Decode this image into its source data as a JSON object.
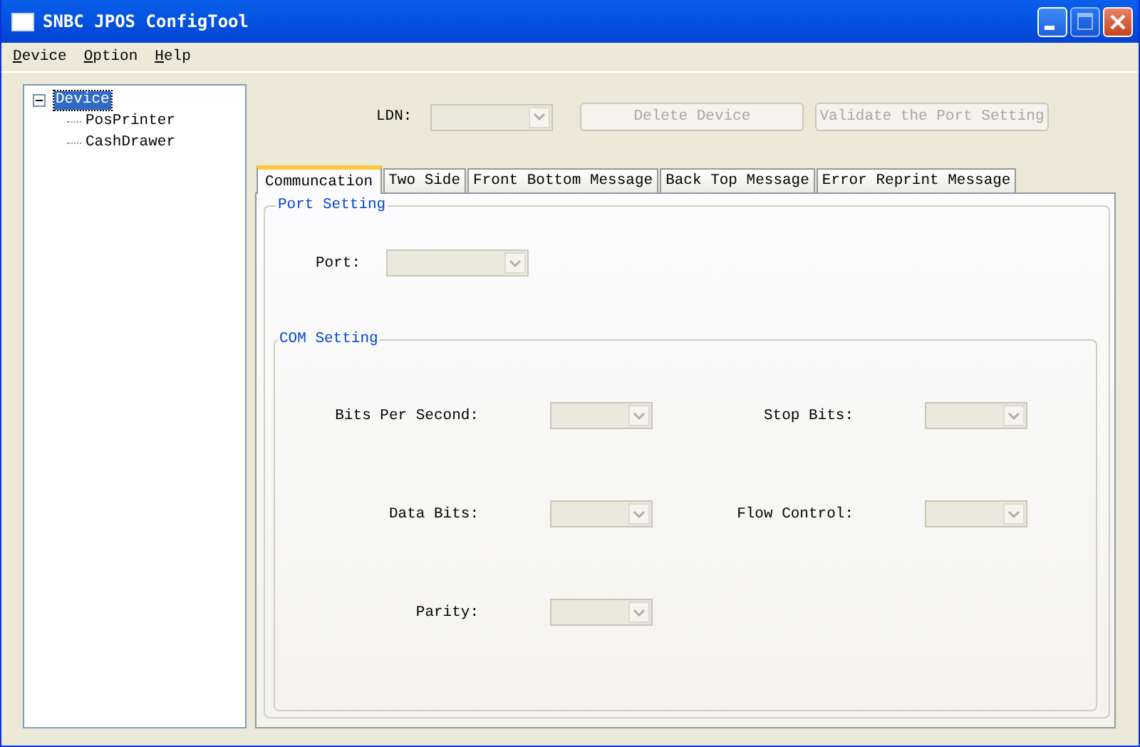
{
  "window": {
    "title": "SNBC JPOS ConfigTool"
  },
  "menu": [
    {
      "label": "Device"
    },
    {
      "label": "Option"
    },
    {
      "label": "Help"
    }
  ],
  "tree": [
    {
      "label": "Device",
      "selected": true,
      "expanded": true,
      "children": [
        {
          "label": "PosPrinter",
          "selected": false
        },
        {
          "label": "CashDrawer",
          "selected": false
        }
      ]
    }
  ],
  "ldn": {
    "label": "LDN:",
    "disabled": true
  },
  "buttons": [
    {
      "label": "Delete Device",
      "disabled": true
    },
    {
      "label": "Validate the Port Setting",
      "disabled": true
    }
  ],
  "tabs": [
    {
      "label": "Communcation",
      "selected": true
    },
    {
      "label": "Two Side",
      "selected": false
    },
    {
      "label": "Front Bottom Message",
      "selected": false
    },
    {
      "label": "Back Top Message",
      "selected": false
    },
    {
      "label": "Error Reprint Message",
      "selected": false
    }
  ],
  "port_setting": {
    "title": "Port Setting",
    "fields": [
      {
        "label": "Port:",
        "disabled": true
      }
    ]
  },
  "com_setting": {
    "title": "COM Setting",
    "fields": [
      {
        "label": "Bits Per Second:",
        "disabled": true
      },
      {
        "label": "Stop Bits:",
        "disabled": true
      },
      {
        "label": "Data Bits:",
        "disabled": true
      },
      {
        "label": "Flow Control:",
        "disabled": true
      },
      {
        "label": "Parity:",
        "disabled": true
      }
    ]
  }
}
